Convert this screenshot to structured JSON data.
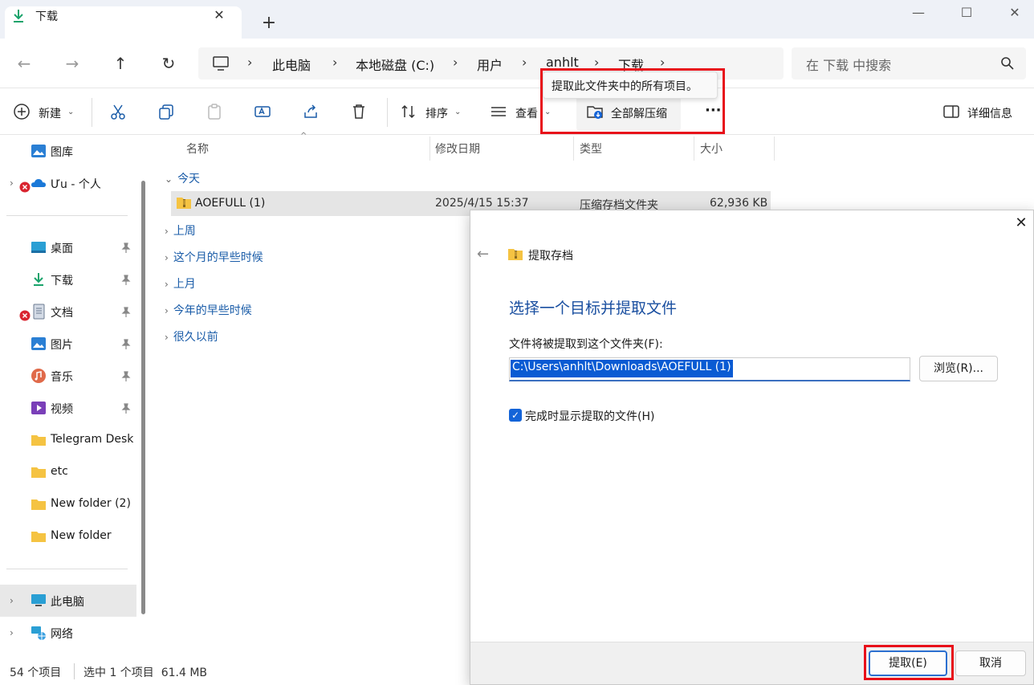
{
  "tab": {
    "title": "下载",
    "close": "✕",
    "new_tab": "+"
  },
  "window": {
    "minimize": "—",
    "maximize": "☐",
    "close": "✕"
  },
  "nav": {
    "back": "←",
    "forward": "→",
    "up": "↑",
    "refresh": "↻"
  },
  "breadcrumb": {
    "items": [
      "此电脑",
      "本地磁盘 (C:)",
      "用户",
      "anhlt",
      "下载"
    ],
    "separator": "›"
  },
  "search": {
    "placeholder": "在 下载 中搜索"
  },
  "toolbar": {
    "new_label": "新建",
    "sort_label": "排序",
    "view_label": "查看",
    "extract_all_label": "全部解压缩",
    "more_label": "···",
    "details_label": "详细信息"
  },
  "tooltip": {
    "text": "提取此文件夹中的所有项目。"
  },
  "sidebar": {
    "items": [
      {
        "label": "图库"
      },
      {
        "label": "Ưu - 个人"
      },
      {
        "label": "桌面"
      },
      {
        "label": "下载"
      },
      {
        "label": "文档"
      },
      {
        "label": "图片"
      },
      {
        "label": "音乐"
      },
      {
        "label": "视频"
      },
      {
        "label": "Telegram Desk"
      },
      {
        "label": "etc"
      },
      {
        "label": "New folder (2)"
      },
      {
        "label": "New folder"
      },
      {
        "label": "此电脑"
      },
      {
        "label": "网络"
      }
    ]
  },
  "columns": {
    "name": "名称",
    "modified": "修改日期",
    "type": "类型",
    "size": "大小"
  },
  "groups": [
    "今天",
    "上周",
    "这个月的早些时候",
    "上月",
    "今年的早些时候",
    "很久以前"
  ],
  "file": {
    "name": "AOEFULL (1)",
    "modified": "2025/4/15 15:37",
    "type": "压缩存档文件夹",
    "size": "62,936 KB"
  },
  "status": {
    "count": "54 个项目",
    "selected": "选中 1 个项目  61.4 MB"
  },
  "dialog": {
    "title": "提取存档",
    "heading": "选择一个目标并提取文件",
    "field_label": "文件将被提取到这个文件夹(F):",
    "path": "C:\\Users\\anhlt\\Downloads\\AOEFULL (1)",
    "browse": "浏览(R)...",
    "checkbox_label": "完成时显示提取的文件(H)",
    "extract": "提取(E)",
    "cancel": "取消",
    "back": "←",
    "close": "✕"
  },
  "colors": {
    "accent": "#1464d8",
    "highlight": "#e8101a",
    "heading": "#1a4fa0"
  }
}
